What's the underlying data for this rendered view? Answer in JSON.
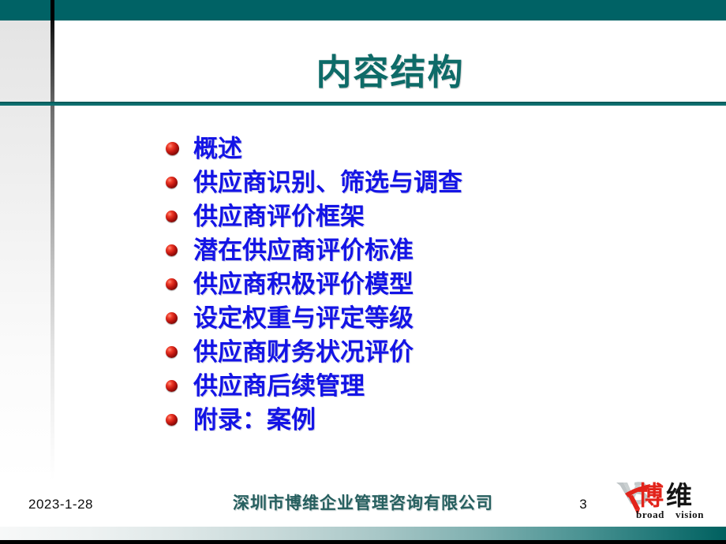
{
  "slide": {
    "title": "内容结构",
    "bullets": [
      {
        "label": "概述"
      },
      {
        "label": "供应商识别、筛选与调查"
      },
      {
        "label": "供应商评价框架"
      },
      {
        "label": "潜在供应商评价标准"
      },
      {
        "label": "供应商积极评价模型"
      },
      {
        "label": "设定权重与评定等级"
      },
      {
        "label": "供应商财务状况评价"
      },
      {
        "label": "供应商后续管理"
      },
      {
        "label": "附录：案例"
      }
    ]
  },
  "footer": {
    "date": "2023-1-28",
    "company": "深圳市博维企业管理咨询有限公司",
    "page_number": "3"
  },
  "logo": {
    "monogram": "BV",
    "char_red": "博",
    "char_black": "维",
    "tagline_word_1": "broad",
    "tagline_word_2": "vision"
  },
  "colors": {
    "teal": "#006265",
    "title_teal": "#0e6b68",
    "bullet_blue": "#1414e6",
    "bullet_marker_red": "#c01610",
    "footer_company_teal": "#265f5f",
    "logo_red": "#e2231a",
    "logo_gray": "#9aa4a6"
  }
}
